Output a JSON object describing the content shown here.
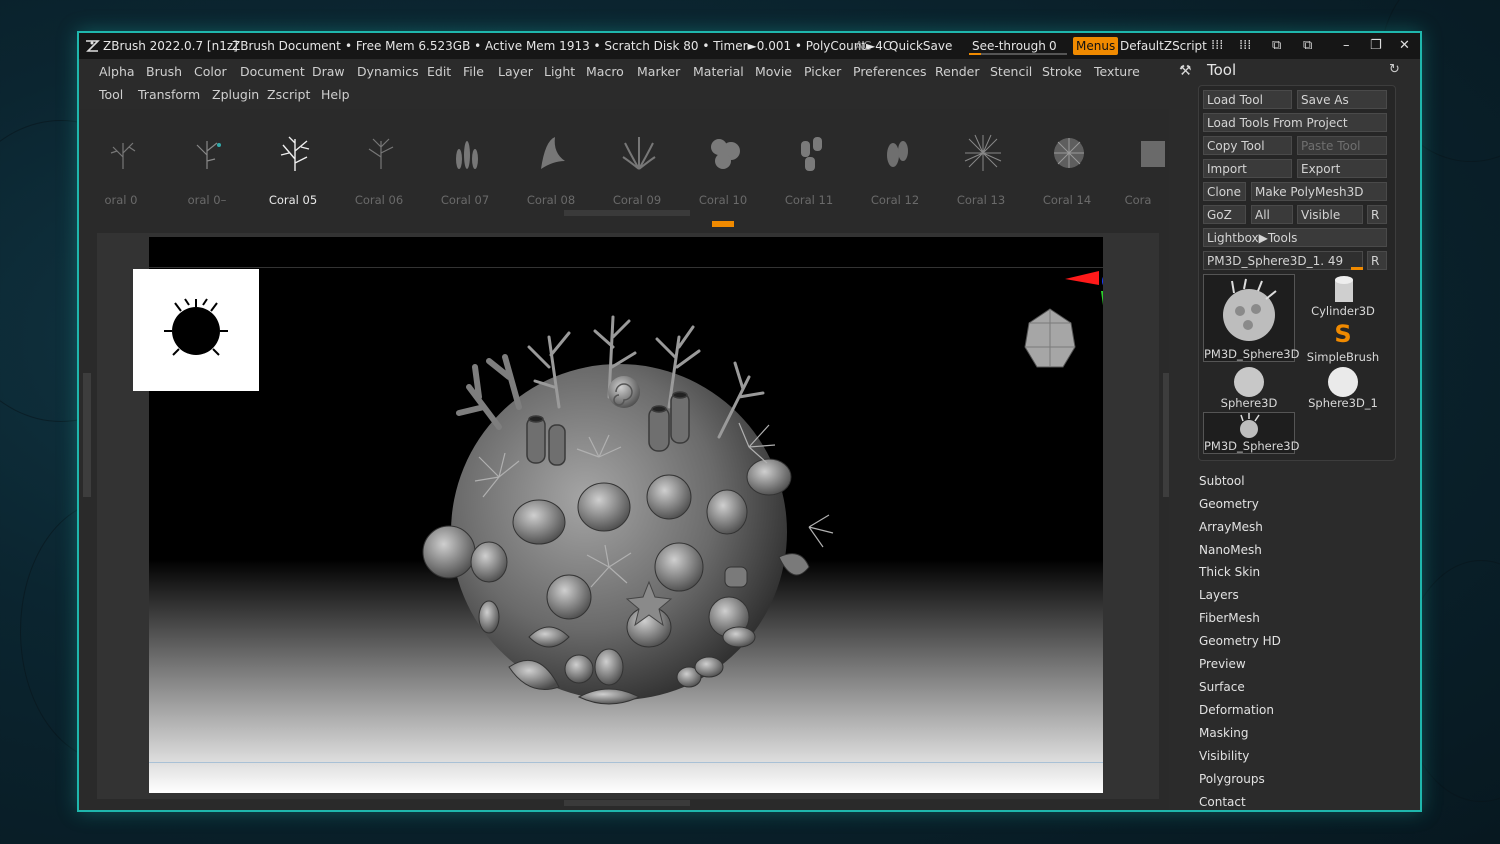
{
  "titlebar": {
    "app": "ZBrush 2022.0.7 [n1z]",
    "document": "ZBrush Document",
    "stats": "• Free Mem 6.523GB • Active Mem 1913 • Scratch Disk 80 • Timer►0.001 • PolyCount►4C",
    "ac": "AC",
    "quicksave": "QuickSave",
    "seethrough": "See-through",
    "seethrough_value": "0",
    "menus": "Menus",
    "zscript": "DefaultZScript"
  },
  "menubar": {
    "row1": [
      "Alpha",
      "Brush",
      "Color",
      "Document",
      "Draw",
      "Dynamics",
      "Edit",
      "File",
      "Layer",
      "Light",
      "Macro",
      "Marker",
      "Material",
      "Movie",
      "Picker",
      "Preferences",
      "Render",
      "Stencil",
      "Stroke",
      "Texture"
    ],
    "row2": [
      "Tool",
      "Transform",
      "Zplugin",
      "Zscript",
      "Help"
    ]
  },
  "shelf": {
    "items": [
      "oral 0",
      "oral 0–",
      "Coral 05",
      "Coral 06",
      "Coral 07",
      "Coral 08",
      "Coral 09",
      "Coral 10",
      "Coral 11",
      "Coral 12",
      "Coral 13",
      "Coral 14",
      "Cora"
    ],
    "active_index": 2
  },
  "tool_panel": {
    "title": "Tool",
    "load_tool": "Load Tool",
    "save_as": "Save As",
    "load_from_project": "Load Tools From Project",
    "copy_tool": "Copy Tool",
    "paste_tool": "Paste Tool",
    "import": "Import",
    "export": "Export",
    "clone": "Clone",
    "make_polymesh": "Make PolyMesh3D",
    "goz": "GoZ",
    "all": "All",
    "visible": "Visible",
    "r": "R",
    "lightbox": "Lightbox▶Tools",
    "current_tool": "PM3D_Sphere3D_1. 49",
    "tools": [
      "PM3D_Sphere3D",
      "Cylinder3D",
      "SimpleBrush",
      "Sphere3D",
      "Sphere3D_1",
      "PM3D_Sphere3D"
    ],
    "subpalettes": [
      "Subtool",
      "Geometry",
      "ArrayMesh",
      "NanoMesh",
      "Thick Skin",
      "Layers",
      "FiberMesh",
      "Geometry HD",
      "Preview",
      "Surface",
      "Deformation",
      "Masking",
      "Visibility",
      "Polygroups",
      "Contact"
    ]
  },
  "colors": {
    "accent": "#f08a00",
    "frame": "#1fb7ad"
  }
}
